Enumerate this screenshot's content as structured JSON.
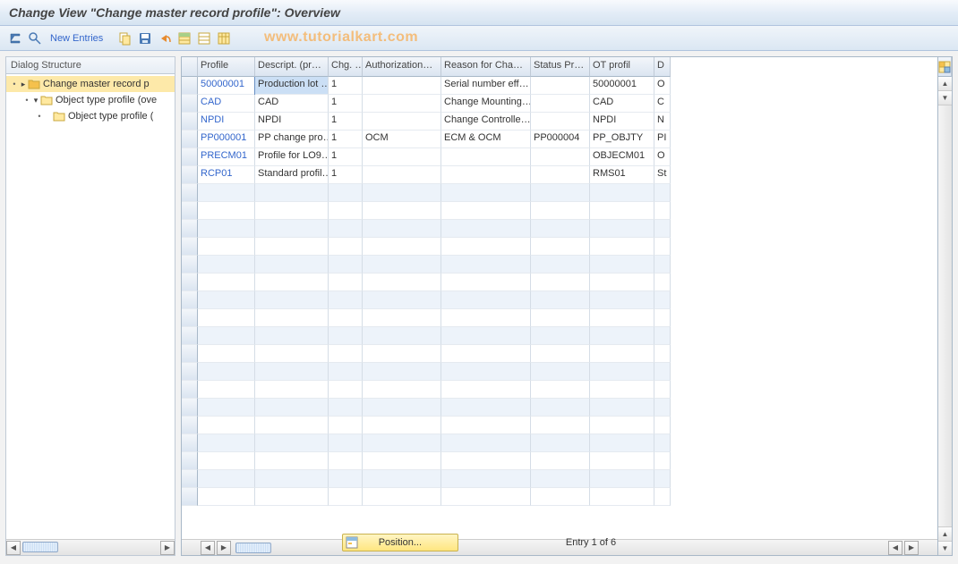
{
  "title": "Change View \"Change master record profile\": Overview",
  "watermark": "www.tutorialkart.com",
  "toolbar": {
    "new_entries": "New Entries"
  },
  "tree": {
    "header": "Dialog Structure",
    "items": [
      {
        "label": "Change master record p",
        "level": 0,
        "selected": true,
        "open": false
      },
      {
        "label": "Object type profile (ove",
        "level": 1,
        "selected": false,
        "open": true
      },
      {
        "label": "Object type profile (",
        "level": 2,
        "selected": false,
        "open": false
      }
    ]
  },
  "table": {
    "columns": [
      "Profile",
      "Descript. (pr…",
      "Chg. …",
      "Authorization…",
      "Reason for Cha…",
      "Status Pr…",
      "OT profil",
      "D"
    ],
    "rows": [
      {
        "profile": "50000001",
        "desc": "Production lot …",
        "chg": "1",
        "auth": "",
        "reason": "Serial number eff…",
        "status": "",
        "ot": "50000001",
        "d": "O"
      },
      {
        "profile": "CAD",
        "desc": "CAD",
        "chg": "1",
        "auth": "",
        "reason": "Change Mounting…",
        "status": "",
        "ot": "CAD",
        "d": "C"
      },
      {
        "profile": "NPDI",
        "desc": "NPDI",
        "chg": "1",
        "auth": "",
        "reason": "Change Controlle…",
        "status": "",
        "ot": "NPDI",
        "d": "N"
      },
      {
        "profile": "PP000001",
        "desc": "PP change pro…",
        "chg": "1",
        "auth": "OCM",
        "reason": "ECM & OCM",
        "status": "PP000004",
        "ot": "PP_OBJTY",
        "d": "PI"
      },
      {
        "profile": "PRECM01",
        "desc": "Profile for LO9…",
        "chg": "1",
        "auth": "",
        "reason": "",
        "status": "",
        "ot": "OBJECM01",
        "d": "O"
      },
      {
        "profile": "RCP01",
        "desc": "Standard profil…",
        "chg": "1",
        "auth": "",
        "reason": "",
        "status": "",
        "ot": "RMS01",
        "d": "St"
      }
    ],
    "empty_rows": 18
  },
  "footer": {
    "position_button": "Position...",
    "entry_text": "Entry 1 of 6"
  }
}
